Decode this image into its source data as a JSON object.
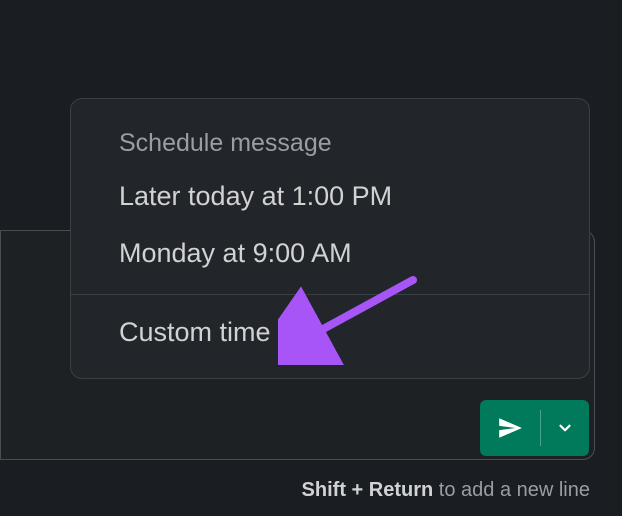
{
  "popover": {
    "header": "Schedule message",
    "options": [
      "Later today at 1:00 PM",
      "Monday at 9:00 AM"
    ],
    "custom": "Custom time"
  },
  "hint": {
    "bold": "Shift + Return",
    "rest": " to add a new line"
  },
  "colors": {
    "accent": "#007a5a",
    "arrow": "#a855f7"
  }
}
